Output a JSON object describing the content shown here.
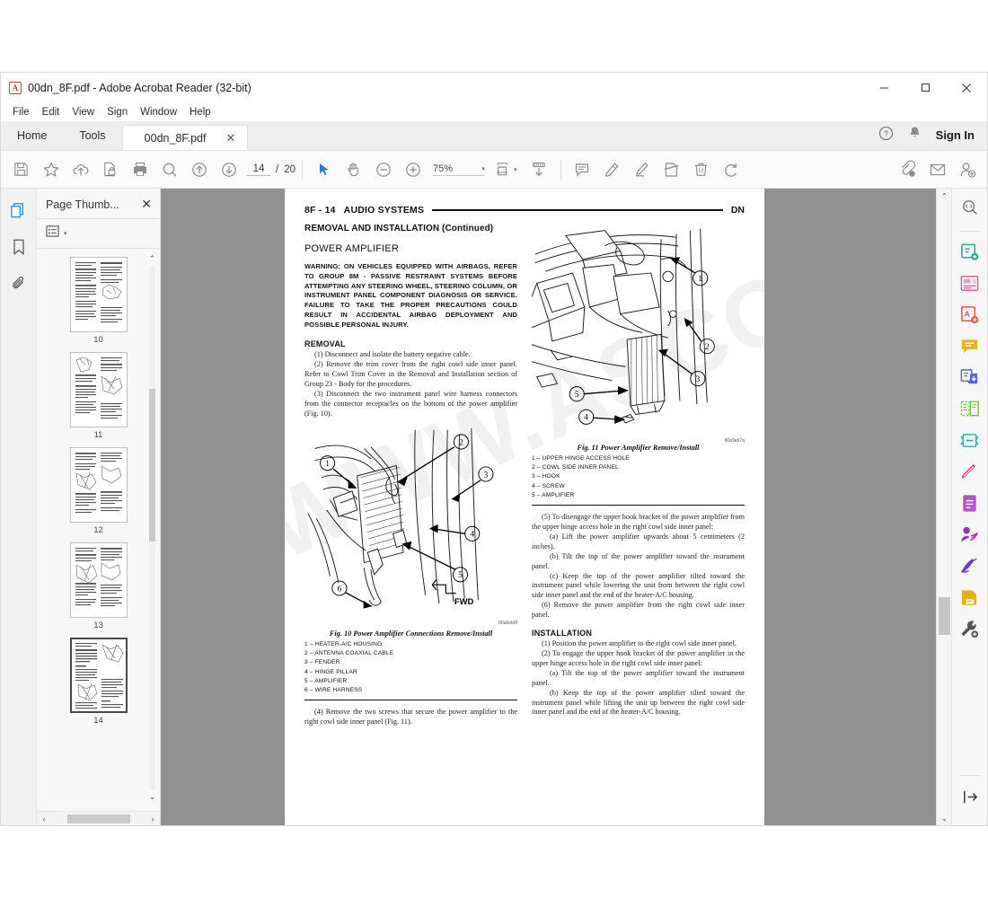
{
  "window": {
    "title": "00dn_8F.pdf - Adobe Acrobat Reader (32-bit)",
    "app_icon": "acrobat-icon",
    "minimize": "–",
    "maximize": "□",
    "close": "✕"
  },
  "menubar": {
    "items": [
      "File",
      "Edit",
      "View",
      "Sign",
      "Window",
      "Help"
    ]
  },
  "tabs": {
    "home": "Home",
    "tools": "Tools",
    "document": "00dn_8F.pdf",
    "close_label": "✕",
    "help_icon": "help-circle-icon",
    "bell_icon": "bell-icon",
    "sign_in": "Sign In"
  },
  "toolbar": {
    "save_label": "save-icon",
    "star_label": "add-to-favorites-icon",
    "upload_label": "upload-cloud-icon",
    "protect_label": "protect-document-icon",
    "print_label": "print-icon",
    "find_label": "find-icon",
    "prev_page_label": "previous-page-icon",
    "next_page_label": "next-page-icon",
    "current_page": "14",
    "page_separator": "/",
    "total_pages": "20",
    "select_tool": "select-cursor-icon",
    "hand_tool": "hand-tool-icon",
    "zoom_out": "zoom-out-icon",
    "zoom_in": "zoom-in-icon",
    "zoom_level": "75%",
    "zoom_caret": "▾",
    "fit_page": "fit-page-icon",
    "fit_caret": "▾",
    "scroll_mode": "page-scrolling-icon",
    "comment": "add-comment-icon",
    "highlight": "highlight-text-icon",
    "underline": "underline-text-icon",
    "strikethrough": "strikethrough-text-icon",
    "delete": "delete-icon",
    "undo": "undo-icon",
    "share_link": "share-link-icon",
    "email": "email-icon",
    "add_person": "add-person-icon"
  },
  "left_rail": {
    "items": [
      {
        "name": "page-thumbnails-icon",
        "active": true
      },
      {
        "name": "bookmarks-icon",
        "active": false
      },
      {
        "name": "attachments-icon",
        "active": false
      }
    ]
  },
  "thumbnail_panel": {
    "title": "Page Thumb...",
    "close": "✕",
    "options_icon": "list-options-icon",
    "options_caret": "▾",
    "scroll_up": "⌃",
    "scroll_down": "⌄",
    "hscroll_left": "‹",
    "hscroll_right": "›",
    "pages": [
      {
        "label": "10",
        "selected": false
      },
      {
        "label": "11",
        "selected": false
      },
      {
        "label": "12",
        "selected": false
      },
      {
        "label": "13",
        "selected": false
      },
      {
        "label": "14",
        "selected": true
      }
    ]
  },
  "document": {
    "watermark": "WWW.ASCOM",
    "running_head": {
      "page_number": "8F - 14",
      "section": "AUDIO SYSTEMS",
      "right_code": "DN"
    },
    "continued_bar": "REMOVAL AND INSTALLATION (Continued)",
    "subject_title": "POWER AMPLIFIER",
    "warning": "WARNING: ON VEHICLES EQUIPPED WITH AIRBAGS, REFER TO GROUP 8M - PASSIVE RESTRAINT SYSTEMS BEFORE ATTEMPTING ANY STEERING WHEEL, STEERING COLUMN, OR INSTRUMENT PANEL COMPONENT DIAGNOSIS OR SERVICE. FAILURE TO TAKE THE PROPER PRECAUTIONS COULD RESULT IN ACCIDENTAL AIRBAG DEPLOYMENT AND POSSIBLE PERSONAL INJURY.",
    "removal_heading": "REMOVAL",
    "removal_steps": [
      "(1) Disconnect and isolate the battery negative cable.",
      "(2) Remove the trim cover from the right cowl side inner panel. Refer to Cowl Trim Cover in the Removal and Installation section of Group 23 - Body for the procedures.",
      "(3) Disconnect the two instrument panel wire harness connectors from the connector receptacles on the bottom of the power amplifier (Fig. 10)."
    ],
    "figure_10": {
      "caption": "Fig. 10 Power Amplifier Connections Remove/Install",
      "code": "80a6eb0f",
      "callout_fwd": "FWD",
      "legend": [
        "1  –  HEATER-A/C HOUSING",
        "2  –  ANTENNA COAXIAL CABLE",
        "3  –  FENDER",
        "4  –  HINGE PILLAR",
        "5  –  AMPLIFIER",
        "6  –  WIRE HARNESS"
      ]
    },
    "step_after_fig10": "(4) Remove the two screws that secure the power amplifier to the right cowl side inner panel (Fig. 11).",
    "figure_11": {
      "caption": "Fig. 11 Power Amplifier Remove/Install",
      "code": "80a9eb7a",
      "legend": [
        "1  –  UPPER HINGE ACCESS HOLE",
        "2  –  COWL SIDE INNER PANEL",
        "3  –  HOOK",
        "4  –  SCREW",
        "5  –  AMPLIFIER"
      ]
    },
    "right_column_steps": [
      "(5) To disengage the upper hook bracket of the power amplifier from the upper hinge access hole in the right cowl side inner panel:",
      "(a) Lift the power amplifier upwards about 5 centimeters (2 inches).",
      "(b) Tilt the top of the power amplifier toward the instrument panel.",
      "(c) Keep the top of the power amplifier tilted toward the instrument panel while lowering the unit from between the right cowl side inner panel and the end of the heater-A/C housing.",
      "(6) Remove the power amplifier from the right cowl side inner panel."
    ],
    "installation_heading": "INSTALLATION",
    "installation_steps": [
      "(1) Position the power amplifier to the right cowl side inner panel.",
      "(2) To engage the upper hook bracket of the power amplifier in the upper hinge access hole in the right cowl side inner panel:",
      "(a) Tilt the top of the power amplifier toward the instrument panel.",
      "(b) Keep the top of the power amplifier tilted toward the instrument panel while lifting the unit up between the right cowl side inner panel and the end of the heater-A/C housing."
    ]
  },
  "right_rail": {
    "items": [
      {
        "name": "search-document-icon",
        "color": "#6e6e6e"
      },
      {
        "name": "create-pdf-icon",
        "color": "#2ba89a"
      },
      {
        "name": "organize-pages-icon",
        "color": "#e0569a"
      },
      {
        "name": "export-pdf-icon",
        "color": "#e0574b"
      },
      {
        "name": "comment-icon",
        "color": "#e8b11f"
      },
      {
        "name": "combine-files-icon",
        "color": "#5a63d8"
      },
      {
        "name": "compare-files-icon",
        "color": "#7dc242"
      },
      {
        "name": "redact-icon",
        "color": "#2bb0a8"
      },
      {
        "name": "edit-pdf-icon",
        "color": "#e0437f"
      },
      {
        "name": "fill-and-sign-icon",
        "color": "#b055c9"
      },
      {
        "name": "request-signatures-icon",
        "color": "#9b32b5"
      },
      {
        "name": "certificates-icon",
        "color": "#6a3ae0"
      },
      {
        "name": "stamp-icon",
        "color": "#ddb318"
      },
      {
        "name": "more-tools-icon",
        "color": "#555555"
      }
    ],
    "collapse_icon": "collapse-panel-icon"
  },
  "viewport": {
    "scroll_up": "⌃",
    "scroll_down": "⌄"
  }
}
